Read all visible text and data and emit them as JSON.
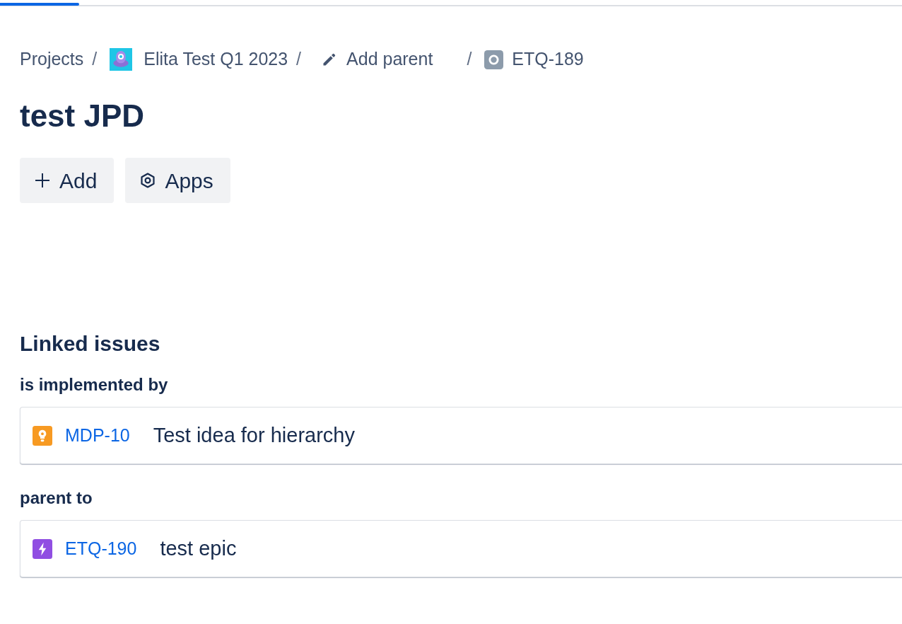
{
  "loading_bar": {
    "level": 0.088
  },
  "breadcrumbs": [
    {
      "kind": "link",
      "label": "Projects",
      "separator": "/"
    },
    {
      "kind": "project",
      "label": "Elita Test Q1 2023",
      "separator": "/"
    },
    {
      "kind": "action",
      "label": "Add parent",
      "separator": "/"
    },
    {
      "kind": "issue",
      "label": "ETQ-189"
    }
  ],
  "title": "test JPD",
  "buttons": [
    {
      "kind": "add",
      "label": "Add"
    },
    {
      "kind": "apps",
      "label": "Apps"
    }
  ],
  "linked_issues": {
    "heading": "Linked issues",
    "groups": [
      {
        "relation": "is implemented by",
        "issues": [
          {
            "kind": "idea",
            "color": "#f79a22",
            "key": "MDP-10",
            "summary": "Test idea for hierarchy"
          }
        ]
      },
      {
        "relation": "parent to",
        "issues": [
          {
            "kind": "epic",
            "color": "#904ee2",
            "key": "ETQ-190",
            "summary": "test epic"
          }
        ]
      }
    ]
  }
}
